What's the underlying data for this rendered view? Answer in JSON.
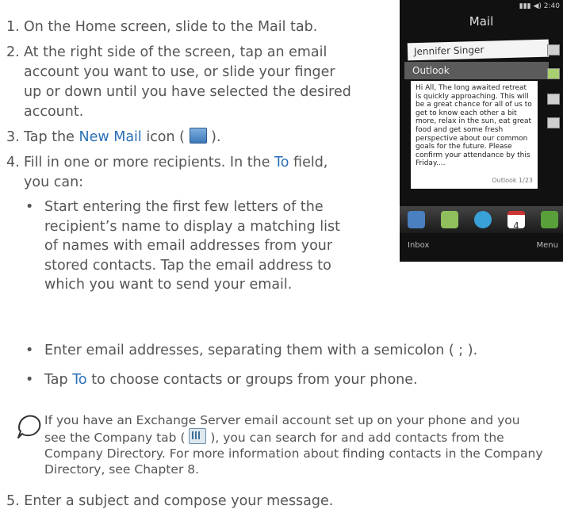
{
  "steps": [
    {
      "num": "1.",
      "text": "On the Home screen, slide to the Mail tab."
    },
    {
      "num": "2.",
      "text": "At the right side of the screen, tap an email account you want to use, or slide your finger up or down until you have selected the desired account."
    },
    {
      "num": "3.",
      "pre": "Tap the ",
      "hl": "New Mail",
      "mid": " icon ( ",
      "post": " )."
    },
    {
      "num": "4.",
      "pre": "Fill in one or more recipients. In the ",
      "hl": "To",
      "post": " field, you can:"
    }
  ],
  "bullets": [
    {
      "dot": "•",
      "text": "Start entering the first few letters of the recipient’s name to display a matching list of names with email addresses from your stored contacts. Tap the email address to which you want to send your email."
    },
    {
      "dot": "•",
      "text": "Enter email addresses, separating them with a semicolon ( ; )."
    },
    {
      "dot": "•",
      "pre": "Tap ",
      "hl": "To",
      "post": " to choose contacts or groups from your phone."
    }
  ],
  "note": {
    "pre": "If you have an Exchange Server email account set up on your phone and you see the Company tab ( ",
    "post": " ), you can search for and add contacts from the Company Directory. For more information about finding contacts in the Company Directory, see Chapter 8."
  },
  "step5": {
    "num": "5.",
    "text": "Enter a subject and compose your message."
  },
  "phone": {
    "time": "2:40",
    "title": "Mail",
    "contact": "Jennifer Singer",
    "account": "Outlook",
    "preview": "Hi All, The long awaited retreat is quickly approaching. This will be a great chance for all of us to get to know each other a bit more, relax in the sun, eat great food and get some fresh perspective about our common goals for the future. Please confirm your attendance by this Friday....",
    "footer": "Outlook 1/23",
    "calendar_day": "4",
    "left_soft": "Inbox",
    "right_soft": "Menu"
  }
}
